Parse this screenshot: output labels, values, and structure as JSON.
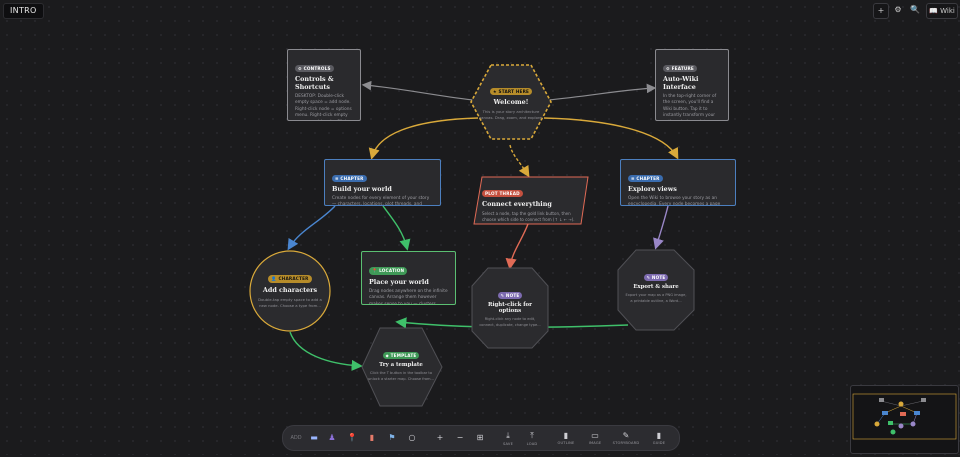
{
  "header": {
    "doc_tab": "INTRO",
    "plus_icon": "+",
    "settings_icon": "⚙",
    "search_icon": "🔍",
    "wiki_label": "📖 Wiki"
  },
  "nodes": {
    "controls": {
      "badge": "⚙ CONTROLS",
      "title": "Controls & Shortcuts",
      "text": "DESKTOP: Double-click empty space = add node. Right-click node = options menu. Right-click empty space = add node. Click..."
    },
    "auto_wiki": {
      "badge": "⚙ FEATURE",
      "title": "Auto-Wiki Interface",
      "text": "In the top-right corner of the screen, you'll find a Wiki button. Tap it to instantly transform your entire mind map into..."
    },
    "welcome": {
      "badge": "★ START HERE",
      "title": "Welcome!",
      "text": "This is your story architecture canvas. Drag, zoom, and explore."
    },
    "build_world": {
      "badge": "≡ CHAPTER",
      "title": "Build your world",
      "text": "Create nodes for every element of your story — characters, locations, plot threads, and notes. Each node is a ..."
    },
    "connect": {
      "badge": "PLOT THREAD",
      "title": "Connect everything",
      "text": "Select a node, tap the gold link button, then choose which side to connect from (↑ ↓ ← →). Tap another node to complete the..."
    },
    "explore": {
      "badge": "≡ CHAPTER",
      "title": "Explore views",
      "text": "Open the Wiki to browse your story as an encyclopedia. Every node becomes a page with cross-references. Use filters to f..."
    },
    "characters": {
      "badge": "👤 CHARACTER",
      "title": "Add characters",
      "text": "Double-tap empty space to add a new node. Choose a type from..."
    },
    "place": {
      "badge": "📍 LOCATION",
      "title": "Place your world",
      "text": "Drag nodes anywhere on the infinite canvas. Arrange them however makes sense to you — clusters, timelines, circles, grids..."
    },
    "right_click": {
      "badge": "✎ NOTE",
      "title": "Right-click for options",
      "text": "Right-click any node to edit, connect, duplicate, change type..."
    },
    "export": {
      "badge": "✎ NOTE",
      "title": "Export & share",
      "text": "Export your map as a PNG image, a printable outline, a Word..."
    },
    "template": {
      "badge": "◆ TEMPLATE",
      "title": "Try a template",
      "text": "Click the T button in the toolbar to unlock a starter map. Choose from..."
    }
  },
  "toolbar": {
    "add_label": "ADD",
    "tools": [
      {
        "icon": "▬",
        "caption": ""
      },
      {
        "icon": "♟",
        "caption": ""
      },
      {
        "icon": "📍",
        "caption": ""
      },
      {
        "icon": "▮",
        "caption": ""
      },
      {
        "icon": "⚑",
        "caption": ""
      },
      {
        "icon": "○",
        "caption": ""
      },
      {
        "icon": "+",
        "caption": ""
      },
      {
        "icon": "−",
        "caption": ""
      },
      {
        "icon": "⊞",
        "caption": ""
      },
      {
        "icon": "⤓",
        "caption": "SAVE"
      },
      {
        "icon": "⤒",
        "caption": "LOAD"
      },
      {
        "icon": "▮",
        "caption": "OUTLINE"
      },
      {
        "icon": "▭",
        "caption": "IMAGE"
      },
      {
        "icon": "✎",
        "caption": "STORYBOARD"
      },
      {
        "icon": "▮",
        "caption": "GUIDE"
      }
    ]
  },
  "colors": {
    "gold": "#d9a93a",
    "blue": "#4a86d0",
    "green": "#3fc06a",
    "red": "#e06a55",
    "purple": "#9a87c8",
    "grey": "#8c8c90"
  }
}
